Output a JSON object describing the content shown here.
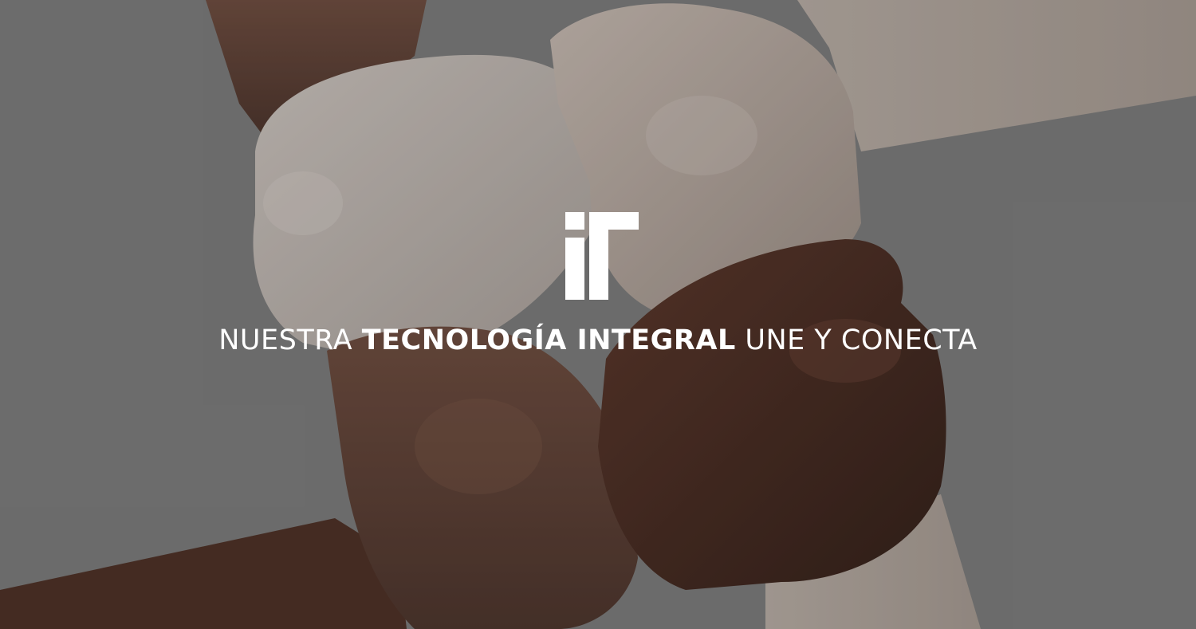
{
  "hero": {
    "background_image": "hands-joined-wrists-photo",
    "logo_icon": "it-logo-icon",
    "tagline": {
      "part1": "NUESTRA ",
      "part2": "TECNOLOGÍA INTEGRAL",
      "part3": " UNE Y CONECTA"
    }
  },
  "colors": {
    "background": "#7b7b7b",
    "text": "#ffffff"
  }
}
